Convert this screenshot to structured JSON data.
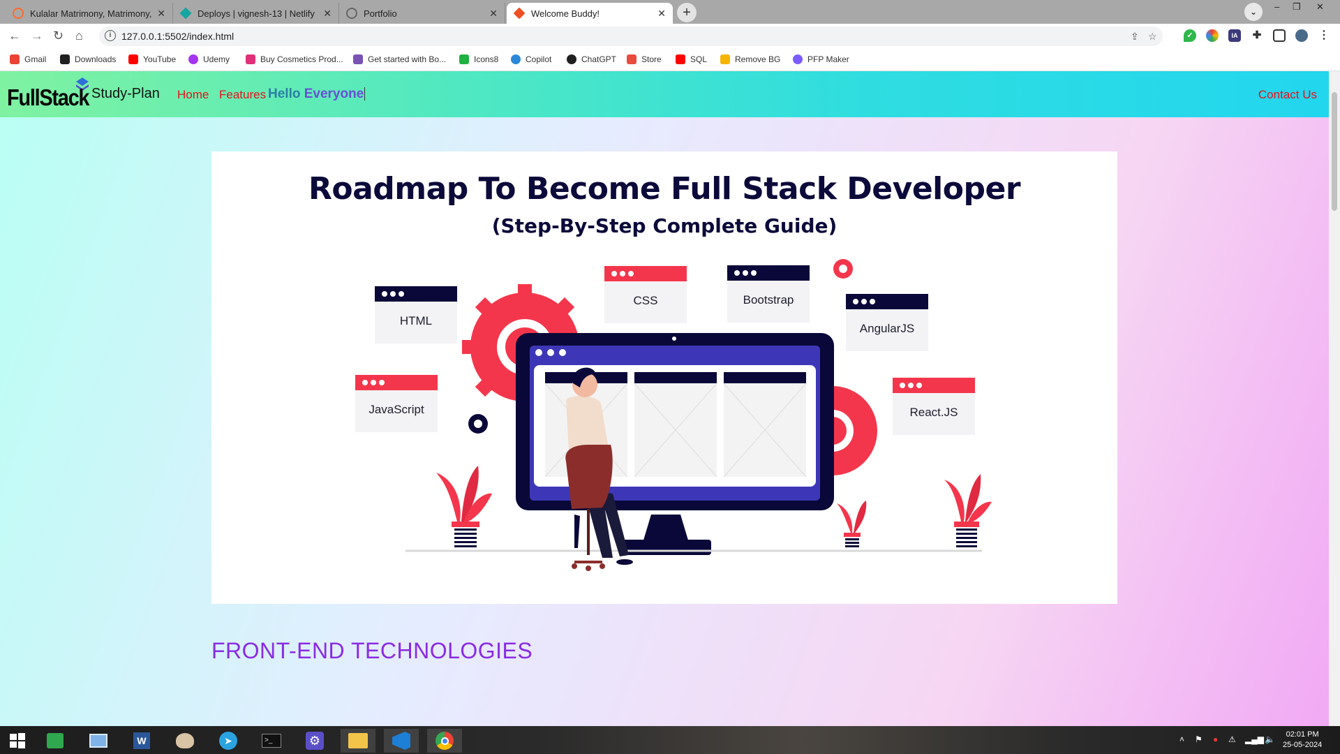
{
  "browser": {
    "tabs": [
      {
        "title": "Kulalar Matrimony, Matrimony, In",
        "active": false,
        "favicon_color": "#ff6a2a"
      },
      {
        "title": "Deploys | vignesh-13 | Netlify",
        "active": false,
        "favicon_color": "#16a6a1"
      },
      {
        "title": "Portfolio",
        "active": false,
        "favicon_color": "#6b6b6b"
      },
      {
        "title": "Welcome Buddy!",
        "active": true,
        "favicon_color": "#f04e23"
      }
    ],
    "new_tab_label": "+",
    "url": "127.0.0.1:5502/index.html",
    "bookmarks": [
      {
        "label": "Gmail",
        "color": "#ea4335"
      },
      {
        "label": "Downloads",
        "color": "#202020"
      },
      {
        "label": "YouTube",
        "color": "#ff0000"
      },
      {
        "label": "Udemy",
        "color": "#a435f0"
      },
      {
        "label": "Buy Cosmetics Prod...",
        "color": "#e0307a"
      },
      {
        "label": "Get started with Bo...",
        "color": "#7952b3"
      },
      {
        "label": "Icons8",
        "color": "#1fb141"
      },
      {
        "label": "Copilot",
        "color": "#2b88d8"
      },
      {
        "label": "ChatGPT",
        "color": "#202020"
      },
      {
        "label": "Store",
        "color": "#e84c3d"
      },
      {
        "label": "SQL",
        "color": "#ff0000"
      },
      {
        "label": "Remove BG",
        "color": "#f5b400"
      },
      {
        "label": "PFP Maker",
        "color": "#7b5cff"
      }
    ]
  },
  "site": {
    "logo_text": "FullStack",
    "brand": "Study-Plan",
    "nav": {
      "home": "Home",
      "features": "Features",
      "contact": "Contact Us"
    },
    "greeting": {
      "word1": "Hello",
      "word2": "Everyone"
    },
    "hero": {
      "title": "Roadmap To Become Full Stack Developer",
      "subtitle": "(Step-By-Step Complete Guide)",
      "cards": [
        "HTML",
        "CSS",
        "Bootstrap",
        "AngularJS",
        "JavaScript",
        "React.JS"
      ]
    },
    "section_heading": "FRONT-END TECHNOLOGIES",
    "colors": {
      "accent_red": "#f4364c",
      "navy": "#0a0838",
      "heading_purple": "#8a2be2",
      "nav_link": "#e8101a"
    }
  },
  "taskbar": {
    "apps": [
      "windows-start",
      "store",
      "remote-desktop",
      "word",
      "paint",
      "telegram",
      "terminal",
      "settings",
      "file-explorer",
      "vscode",
      "chrome"
    ],
    "time": "02:01 PM",
    "date": "25-05-2024"
  }
}
